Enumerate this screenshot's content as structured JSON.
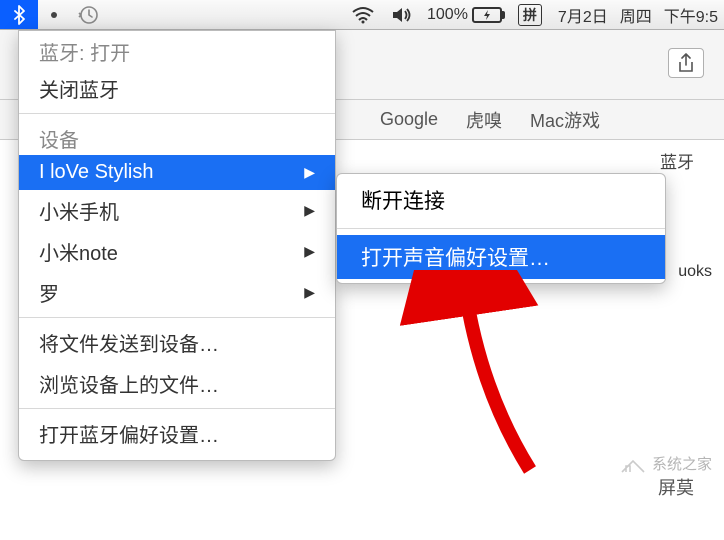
{
  "menubar": {
    "battery_percent": "100%",
    "input_method": "拼",
    "date": "7月2日",
    "weekday": "周四",
    "time": "下午9:5"
  },
  "browser": {
    "bookmarks": [
      "Google",
      "虎嗅",
      "Mac游戏"
    ],
    "tab_label_partial": "蓝牙",
    "side_text": "uoks"
  },
  "bt_menu": {
    "status_label": "蓝牙: 打开",
    "turn_off": "关闭蓝牙",
    "devices_label": "设备",
    "devices": [
      "I loVe Stylish",
      "小米手机",
      "小米note",
      "罗"
    ],
    "send_file": "将文件发送到设备…",
    "browse_files": "浏览设备上的文件…",
    "open_prefs": "打开蓝牙偏好设置…"
  },
  "submenu": {
    "disconnect": "断开连接",
    "open_sound_prefs": "打开声音偏好设置…"
  },
  "footer": {
    "text": "屏莫",
    "watermark": "系统之家"
  }
}
